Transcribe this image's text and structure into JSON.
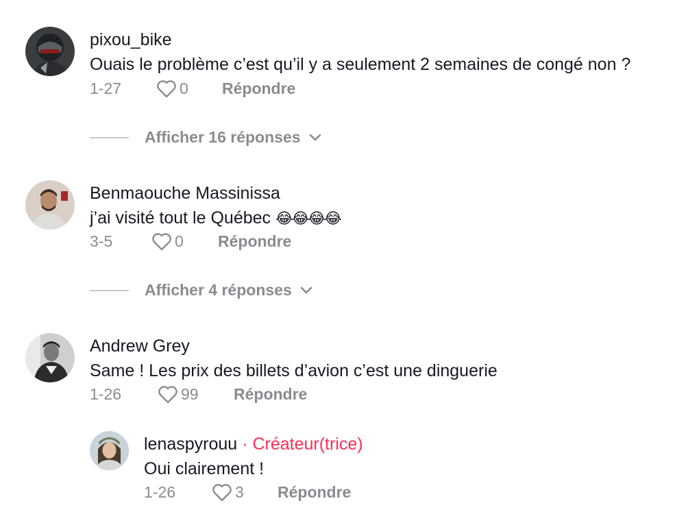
{
  "comments": [
    {
      "username": "pixou_bike",
      "text": "Ouais le problème c’est qu’il y a seulement 2 semaines de congé non ?",
      "date": "1-27",
      "likes": "0",
      "reply_label": "Répondre",
      "more_replies": "Afficher 16 réponses"
    },
    {
      "username": "Benmaouche Massinissa",
      "text": "j’ai visité tout le Québec",
      "emoji": "😂😂😂😂",
      "date": "3-5",
      "likes": "0",
      "reply_label": "Répondre",
      "more_replies": "Afficher 4 réponses"
    },
    {
      "username": "Andrew Grey",
      "text": "Same ! Les prix des billets d’avion c’est une dinguerie",
      "date": "1-26",
      "likes": "99",
      "reply_label": "Répondre",
      "replies": [
        {
          "username": "lenaspyrouu",
          "creator_tag": "· Créateur(trice)",
          "text": "Oui clairement !",
          "date": "1-26",
          "likes": "3",
          "reply_label": "Répondre"
        }
      ]
    }
  ],
  "icons": {
    "like": "heart-outline-icon",
    "expand": "chevron-down-icon"
  },
  "colors": {
    "primary_text": "#161823",
    "secondary_text": "#8a8b91",
    "creator_accent": "#fe2c55"
  }
}
